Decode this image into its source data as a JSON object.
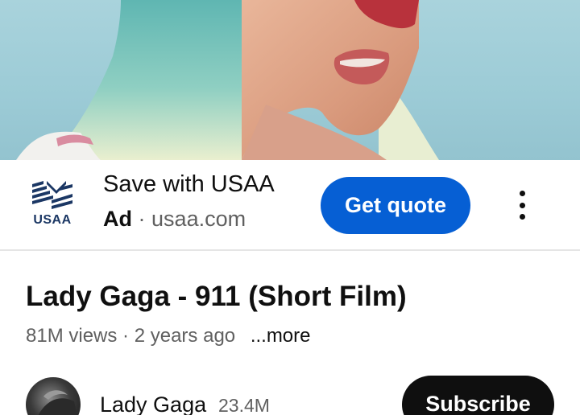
{
  "video": {
    "thumbnail": "music-video-frame"
  },
  "ad": {
    "logo_text": "USAA",
    "title": "Save with USAA",
    "badge": "Ad",
    "separator": "·",
    "domain": "usaa.com",
    "cta_label": "Get quote",
    "menu_icon": "more-vert-icon",
    "cta_color": "#065fd4"
  },
  "details": {
    "title": "Lady Gaga - 911 (Short Film)",
    "views": "81M views",
    "separator": "·",
    "age": "2 years ago",
    "more_label": "...more"
  },
  "channel": {
    "name": "Lady Gaga",
    "subscribers": "23.4M",
    "subscribe_label": "Subscribe"
  }
}
